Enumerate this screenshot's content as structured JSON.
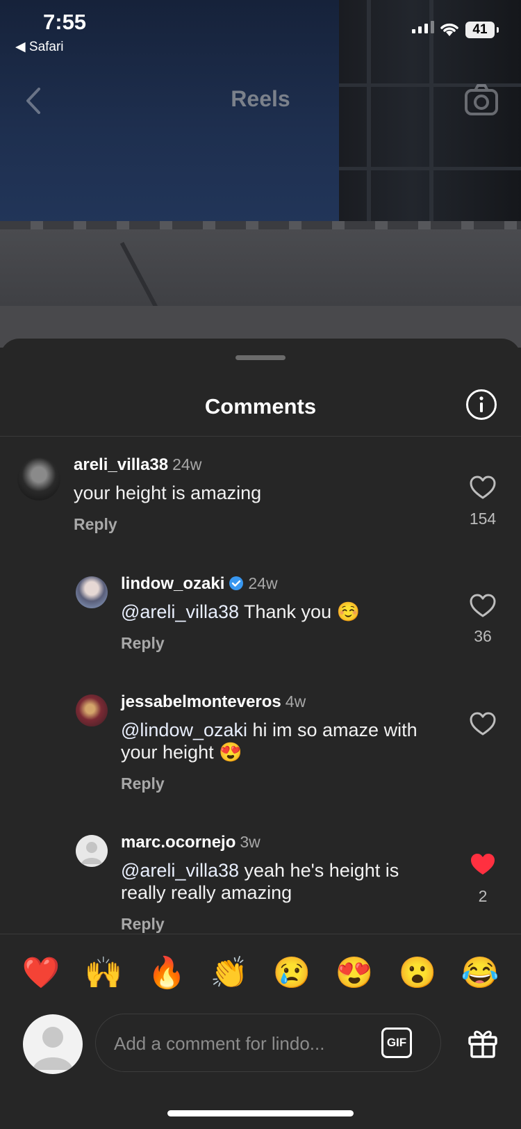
{
  "status_bar": {
    "time": "7:55",
    "back_app": "◀ Safari",
    "battery": "41"
  },
  "topbar": {
    "title": "Reels",
    "back_icon": "chevron-left-icon",
    "camera_icon": "camera-icon"
  },
  "sheet": {
    "title": "Comments",
    "info_icon": "info-icon"
  },
  "comments": [
    {
      "username": "areli_villa38",
      "age": "24w",
      "mention": "",
      "text": "your height is amazing",
      "reply": "Reply",
      "likes": "154",
      "liked": false
    },
    {
      "username": "lindow_ozaki",
      "age": "24w",
      "verified": true,
      "mention": "@areli_villa38",
      "text": " Thank you ☺️",
      "reply": "Reply",
      "likes": "36",
      "liked": false
    },
    {
      "username": "jessabelmonteveros",
      "age": "4w",
      "mention": "@lindow_ozaki",
      "text": "  hi im so amaze with your height 😍",
      "reply": "Reply",
      "likes": "",
      "liked": false
    },
    {
      "username": "marc.ocornejo",
      "age": "3w",
      "mention": "@areli_villa38",
      "text": " yeah he's height is really really amazing",
      "reply": "Reply",
      "likes": "2",
      "liked": true
    }
  ],
  "emoji_reactions": [
    "❤️",
    "🙌",
    "🔥",
    "👏",
    "😢",
    "😍",
    "😮",
    "😂"
  ],
  "composer": {
    "placeholder": "Add a comment for lindo...",
    "gif_label": "GIF",
    "gift_icon": "gift-icon"
  },
  "colors": {
    "sheet_bg": "#262626",
    "like_red": "#ff3040",
    "verified_blue": "#3897f0"
  }
}
